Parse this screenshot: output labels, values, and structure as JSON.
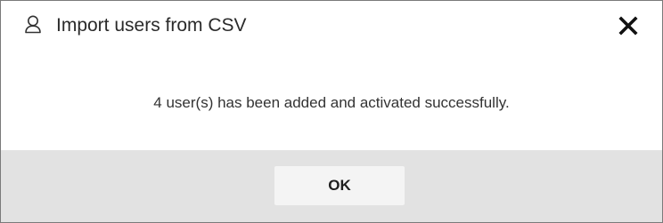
{
  "dialog": {
    "title": "Import users from CSV",
    "icons": {
      "title_icon": "user-icon",
      "close_icon": "close-icon"
    },
    "message": "4 user(s) has been added and activated successfully.",
    "ok_label": "OK"
  },
  "colors": {
    "footer_background": "#e2e2e2",
    "button_background": "#f4f4f4",
    "border": "#7a7a7a"
  }
}
